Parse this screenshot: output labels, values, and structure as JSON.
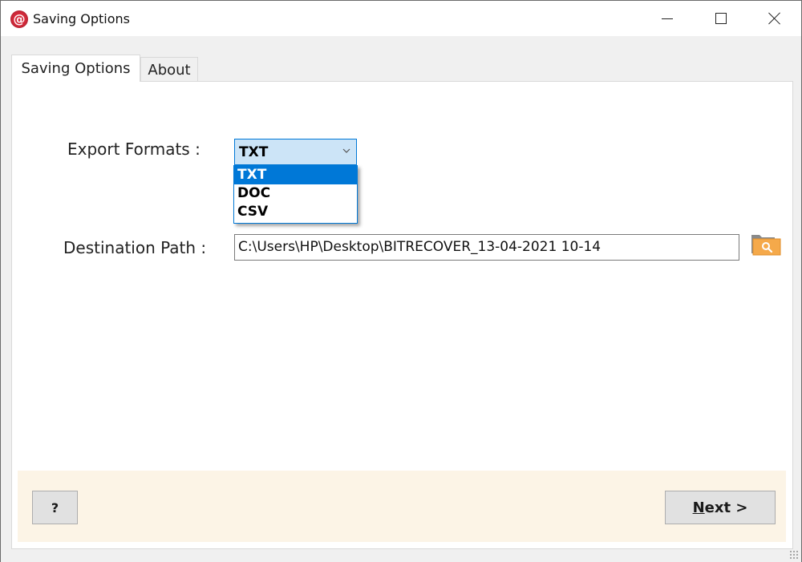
{
  "window": {
    "title": "Saving Options",
    "app_icon": "at-sign-icon",
    "controls": {
      "minimize": "minimize-icon",
      "maximize": "maximize-icon",
      "close": "close-icon"
    }
  },
  "tabs": [
    {
      "label": "Saving Options",
      "active": true
    },
    {
      "label": "About",
      "active": false
    }
  ],
  "form": {
    "export_formats": {
      "label": "Export Formats :",
      "selected": "TXT",
      "options": [
        "TXT",
        "DOC",
        "CSV"
      ],
      "highlighted": "TXT",
      "expanded": true
    },
    "destination_path": {
      "label": "Destination Path :",
      "value": "C:\\Users\\HP\\Desktop\\BITRECOVER_13-04-2021 10-14",
      "browse_icon": "folder-search-icon"
    }
  },
  "footer": {
    "help_label": "?",
    "next_label_mnemonic": "N",
    "next_label_rest": "ext >"
  },
  "colors": {
    "accent": "#0078d7",
    "combo_bg": "#cce4f7",
    "footer_bg": "#fcf4e6",
    "app_icon_red": "#d42a3b",
    "folder_orange": "#f5a94a"
  }
}
